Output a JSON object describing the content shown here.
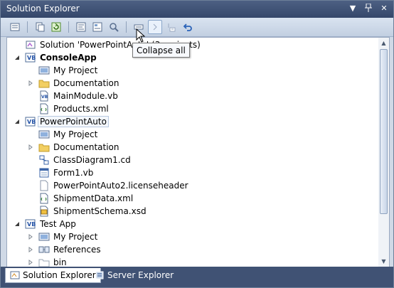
{
  "window": {
    "title": "Solution Explorer",
    "controls": {
      "menu": "▼",
      "pin": "ㅐ",
      "close": "✕"
    }
  },
  "toolbar": {
    "tooltip": "Collapse all"
  },
  "tree": {
    "rows": [
      {
        "label": "Solution 'PowerPointAuto' (3 projects)",
        "indent": 0,
        "exp": "",
        "icon": "solution-icon",
        "bold": false,
        "selected": false
      },
      {
        "label": "ConsoleApp",
        "indent": 0,
        "exp": "open",
        "icon": "vb-project-icon",
        "bold": true,
        "selected": false
      },
      {
        "label": "My Project",
        "indent": 1,
        "exp": "",
        "icon": "my-project-icon",
        "bold": false,
        "selected": false
      },
      {
        "label": "Documentation",
        "indent": 1,
        "exp": "closed",
        "icon": "folder-icon",
        "bold": false,
        "selected": false
      },
      {
        "label": "MainModule.vb",
        "indent": 1,
        "exp": "",
        "icon": "vb-file-icon",
        "bold": false,
        "selected": false
      },
      {
        "label": "Products.xml",
        "indent": 1,
        "exp": "",
        "icon": "xml-file-icon",
        "bold": false,
        "selected": false
      },
      {
        "label": "PowerPointAuto",
        "indent": 0,
        "exp": "open",
        "icon": "vb-project-icon",
        "bold": false,
        "selected": true
      },
      {
        "label": "My Project",
        "indent": 1,
        "exp": "",
        "icon": "my-project-icon",
        "bold": false,
        "selected": false
      },
      {
        "label": "Documentation",
        "indent": 1,
        "exp": "closed",
        "icon": "folder-icon",
        "bold": false,
        "selected": false
      },
      {
        "label": "ClassDiagram1.cd",
        "indent": 1,
        "exp": "",
        "icon": "class-diagram-icon",
        "bold": false,
        "selected": false
      },
      {
        "label": "Form1.vb",
        "indent": 1,
        "exp": "",
        "icon": "form-file-icon",
        "bold": false,
        "selected": false
      },
      {
        "label": "PowerPointAuto2.licenseheader",
        "indent": 1,
        "exp": "",
        "icon": "blank-file-icon",
        "bold": false,
        "selected": false
      },
      {
        "label": "ShipmentData.xml",
        "indent": 1,
        "exp": "",
        "icon": "xml-file-icon",
        "bold": false,
        "selected": false
      },
      {
        "label": "ShipmentSchema.xsd",
        "indent": 1,
        "exp": "",
        "icon": "xsd-file-icon",
        "bold": false,
        "selected": false
      },
      {
        "label": "Test App",
        "indent": 0,
        "exp": "open",
        "icon": "vb-project-icon",
        "bold": false,
        "selected": false
      },
      {
        "label": "My Project",
        "indent": 1,
        "exp": "closed",
        "icon": "my-project-icon",
        "bold": false,
        "selected": false
      },
      {
        "label": "References",
        "indent": 1,
        "exp": "closed",
        "icon": "references-icon",
        "bold": false,
        "selected": false
      },
      {
        "label": "bin",
        "indent": 1,
        "exp": "closed",
        "icon": "folder-outline-icon",
        "bold": false,
        "selected": false
      }
    ]
  },
  "tabs": [
    {
      "label": "Solution Explorer",
      "icon": "solution-explorer-tab-icon",
      "active": true
    },
    {
      "label": "Server Explorer",
      "icon": "server-explorer-tab-icon",
      "active": false
    }
  ],
  "colors": {
    "titlebar": "#3f5276",
    "tabstrip": "#405274",
    "selection": "#f3f7fc"
  }
}
